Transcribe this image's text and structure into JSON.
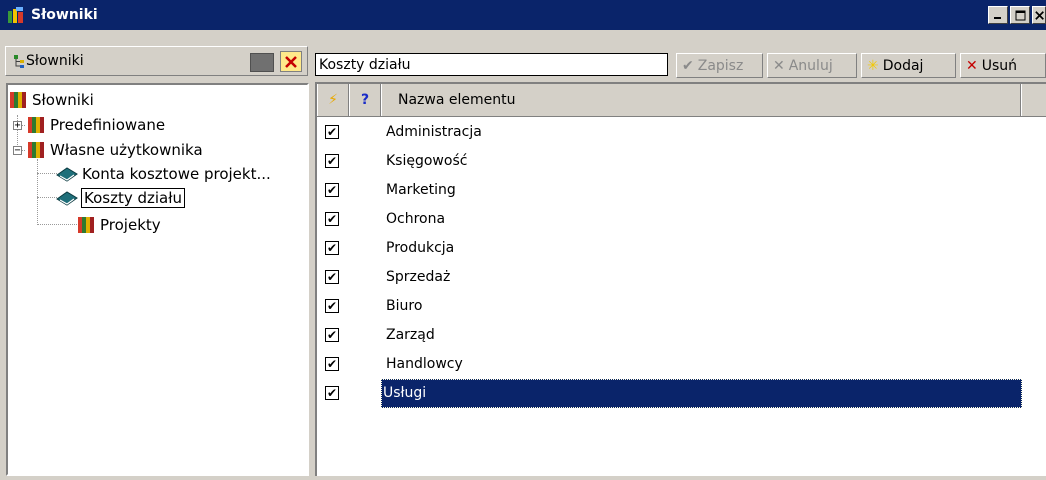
{
  "window": {
    "title": "Słowniki"
  },
  "left_panel": {
    "title": "Słowniki"
  },
  "tree": {
    "root": "Słowniki",
    "nodes": [
      "Predefiniowane",
      "Własne użytkownika",
      "Konta kosztowe projekt...",
      "Koszty działu",
      "Projekty"
    ]
  },
  "editor": {
    "value": "Koszty działu"
  },
  "toolbar": {
    "save": "Zapisz",
    "cancel": "Anuluj",
    "add": "Dodaj",
    "delete": "Usuń"
  },
  "grid": {
    "header_col1": "⚡",
    "header_col2": "?",
    "header_name": "Nazwa elementu",
    "rows": [
      {
        "checked": true,
        "label": "Administracja"
      },
      {
        "checked": true,
        "label": "Księgowość"
      },
      {
        "checked": true,
        "label": "Marketing"
      },
      {
        "checked": true,
        "label": "Ochrona"
      },
      {
        "checked": true,
        "label": "Produkcja"
      },
      {
        "checked": true,
        "label": "Sprzedaż"
      },
      {
        "checked": true,
        "label": "Biuro"
      },
      {
        "checked": true,
        "label": "Zarząd"
      },
      {
        "checked": true,
        "label": "Handlowcy"
      },
      {
        "checked": true,
        "label": "Usługi"
      }
    ],
    "selected_row": 9
  },
  "colors": {
    "titlebar": "#0a246a",
    "selection": "#0a246a",
    "face": "#d4d0c8"
  },
  "icons": {
    "title": "books-app-icon",
    "tree_root": "bookshelf-icon",
    "tree_leaf": "book-icon",
    "toolbar_add": "sun-icon",
    "toolbar_delete": "x-icon"
  }
}
